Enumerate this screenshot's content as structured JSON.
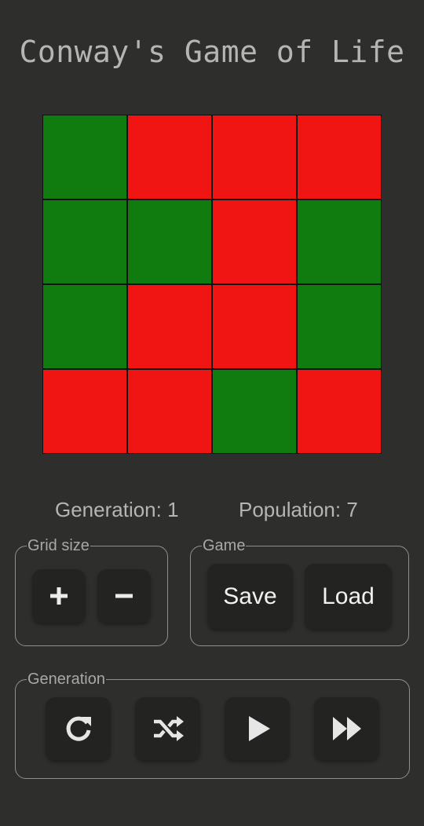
{
  "title": "Conway's Game of Life",
  "grid": {
    "rows": 4,
    "cols": 4,
    "cells": [
      [
        1,
        0,
        0,
        0
      ],
      [
        1,
        1,
        0,
        1
      ],
      [
        1,
        0,
        0,
        1
      ],
      [
        0,
        0,
        1,
        0
      ]
    ],
    "alive_color": "#107c10",
    "dead_color": "#f01412"
  },
  "stats": {
    "generation_text": "Generation: 1",
    "population_text": "Population: 7"
  },
  "grid_size_panel": {
    "legend": "Grid size",
    "increase_icon": "plus-icon",
    "decrease_icon": "minus-icon"
  },
  "game_panel": {
    "legend": "Game",
    "save_label": "Save",
    "load_label": "Load"
  },
  "generation_panel": {
    "legend": "Generation",
    "buttons": [
      "reset-icon",
      "shuffle-icon",
      "play-icon",
      "fast-forward-icon"
    ]
  },
  "colors": {
    "background": "#2e2e2d",
    "button_bg": "#232322",
    "text": "#b5b5b5"
  }
}
